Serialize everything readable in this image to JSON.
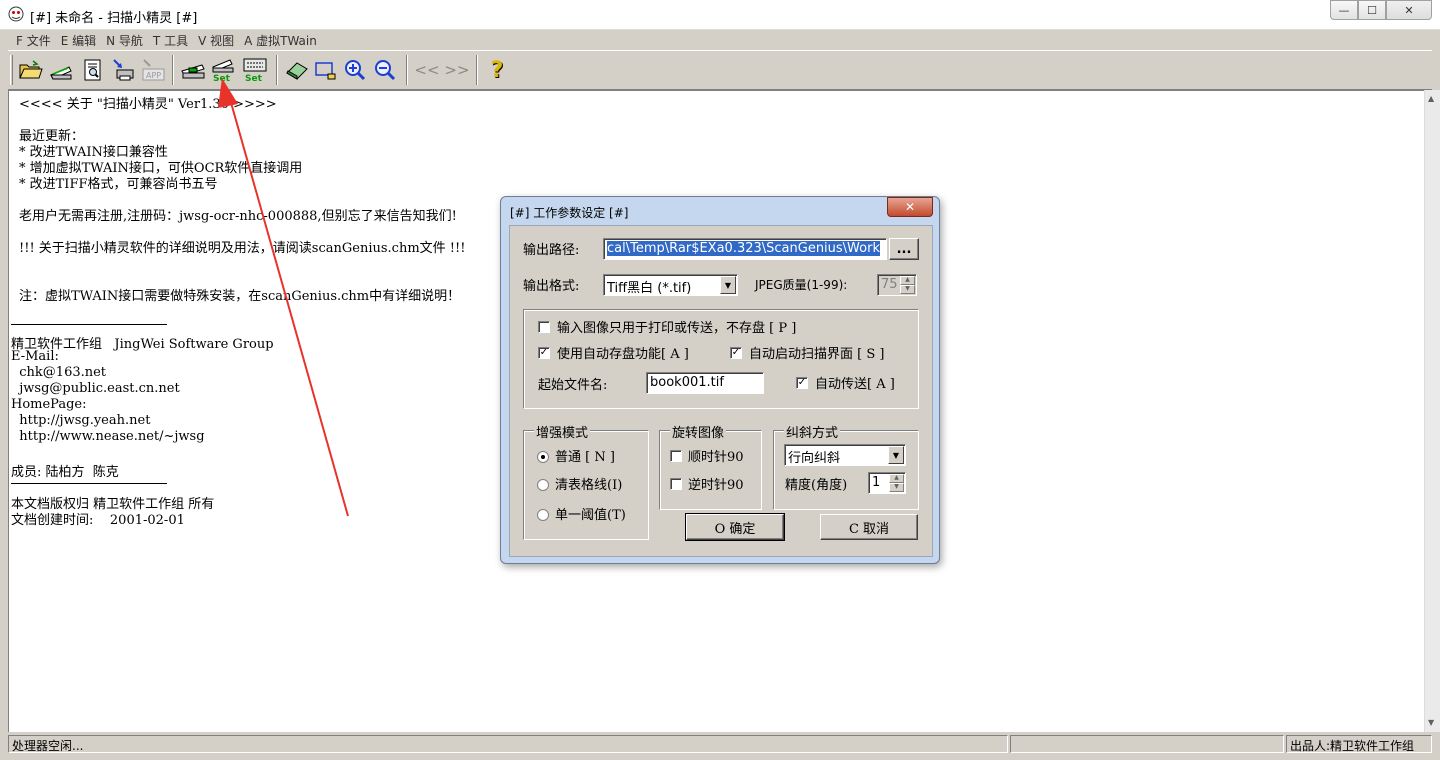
{
  "window": {
    "title": "[#] 未命名 - 扫描小精灵 [#]",
    "min_glyph": "—",
    "max_glyph": "☐",
    "close_glyph": "✕"
  },
  "menu": [
    {
      "label": "F 文件"
    },
    {
      "label": "E 编辑"
    },
    {
      "label": "N 导航"
    },
    {
      "label": "T 工具"
    },
    {
      "label": "V 视图"
    },
    {
      "label": "A 虚拟TWain"
    }
  ],
  "toolbar": {
    "set_label_1": "Set",
    "set_label_2": "Set",
    "app_label": "APP",
    "prev_glyph": "<<",
    "next_glyph": ">>",
    "help_glyph": "?"
  },
  "document": {
    "lines": [
      "<<<< 关于 \"扫描小精灵\" Ver1.30 >>>>",
      "最近更新：",
      "* 改进TWAIN接口兼容性",
      "* 增加虚拟TWAIN接口，可供OCR软件直接调用",
      "* 改进TIFF格式，可兼容尚书五号",
      "老用户无需再注册,注册码：jwsg-ocr-nhc-000888,但别忘了来信告知我们!",
      "!!! 关于扫描小精灵软件的详细说明及用法，请阅读scanGenius.chm文件 !!!",
      "注：虚拟TWAIN接口需要做特殊安装，在scanGenius.chm中有详细说明！",
      "精卫软件工作组   JingWei Software Group",
      "E-Mail:",
      "  chk@163.net",
      "  jwsg@public.east.cn.net",
      "HomePage:",
      "  http://jwsg.yeah.net",
      "  http://www.nease.net/~jwsg",
      "成员: 陆柏方  陈克",
      "本文档版权归 精卫软件工作组 所有",
      "文档创建时间:    2001-02-01"
    ]
  },
  "status": {
    "left": "处理器空闲...",
    "right": "出品人:精卫软件工作组"
  },
  "dialog": {
    "title": "[#] 工作参数设定 [#]",
    "close_glyph": "✕",
    "output_path_label": "输出路径:",
    "output_path_value": "cal\\Temp\\Rar$EXa0.323\\ScanGenius\\Work",
    "browse_label": "...",
    "output_format_label": "输出格式:",
    "output_format_value": "Tiff黑白 (*.tif)",
    "jpeg_quality_label": "JPEG质量(1-99):",
    "jpeg_quality_value": "75",
    "opt_print_only": "输入图像只用于打印或传送，不存盘 [ P ]",
    "opt_print_only_checked": false,
    "opt_autosave": "使用自动存盘功能[ A ]",
    "opt_autosave_checked": true,
    "opt_autoscan": "自动启动扫描界面 [ S ]",
    "opt_autoscan_checked": true,
    "start_filename_label": "起始文件名:",
    "start_filename_value": "book001.tif",
    "opt_autosend": "自动传送[ A ]",
    "opt_autosend_checked": true,
    "enhance": {
      "title": "增强模式",
      "options": [
        {
          "label": "普通 [ N ]",
          "selected": true
        },
        {
          "label": "清表格线(I)",
          "selected": false
        },
        {
          "label": "单一阈值(T)",
          "selected": false
        }
      ]
    },
    "rotate": {
      "title": "旋转图像",
      "cw": "顺时针90",
      "ccw": "逆时针90"
    },
    "deskew": {
      "title": "纠斜方式",
      "mode_value": "行向纠斜",
      "precision_label": "精度(角度)",
      "precision_value": "1"
    },
    "ok_label": "O 确定",
    "cancel_label": "C 取消"
  },
  "colors": {
    "annotation_arrow": "#e8332a",
    "selection": "#3169c6"
  }
}
